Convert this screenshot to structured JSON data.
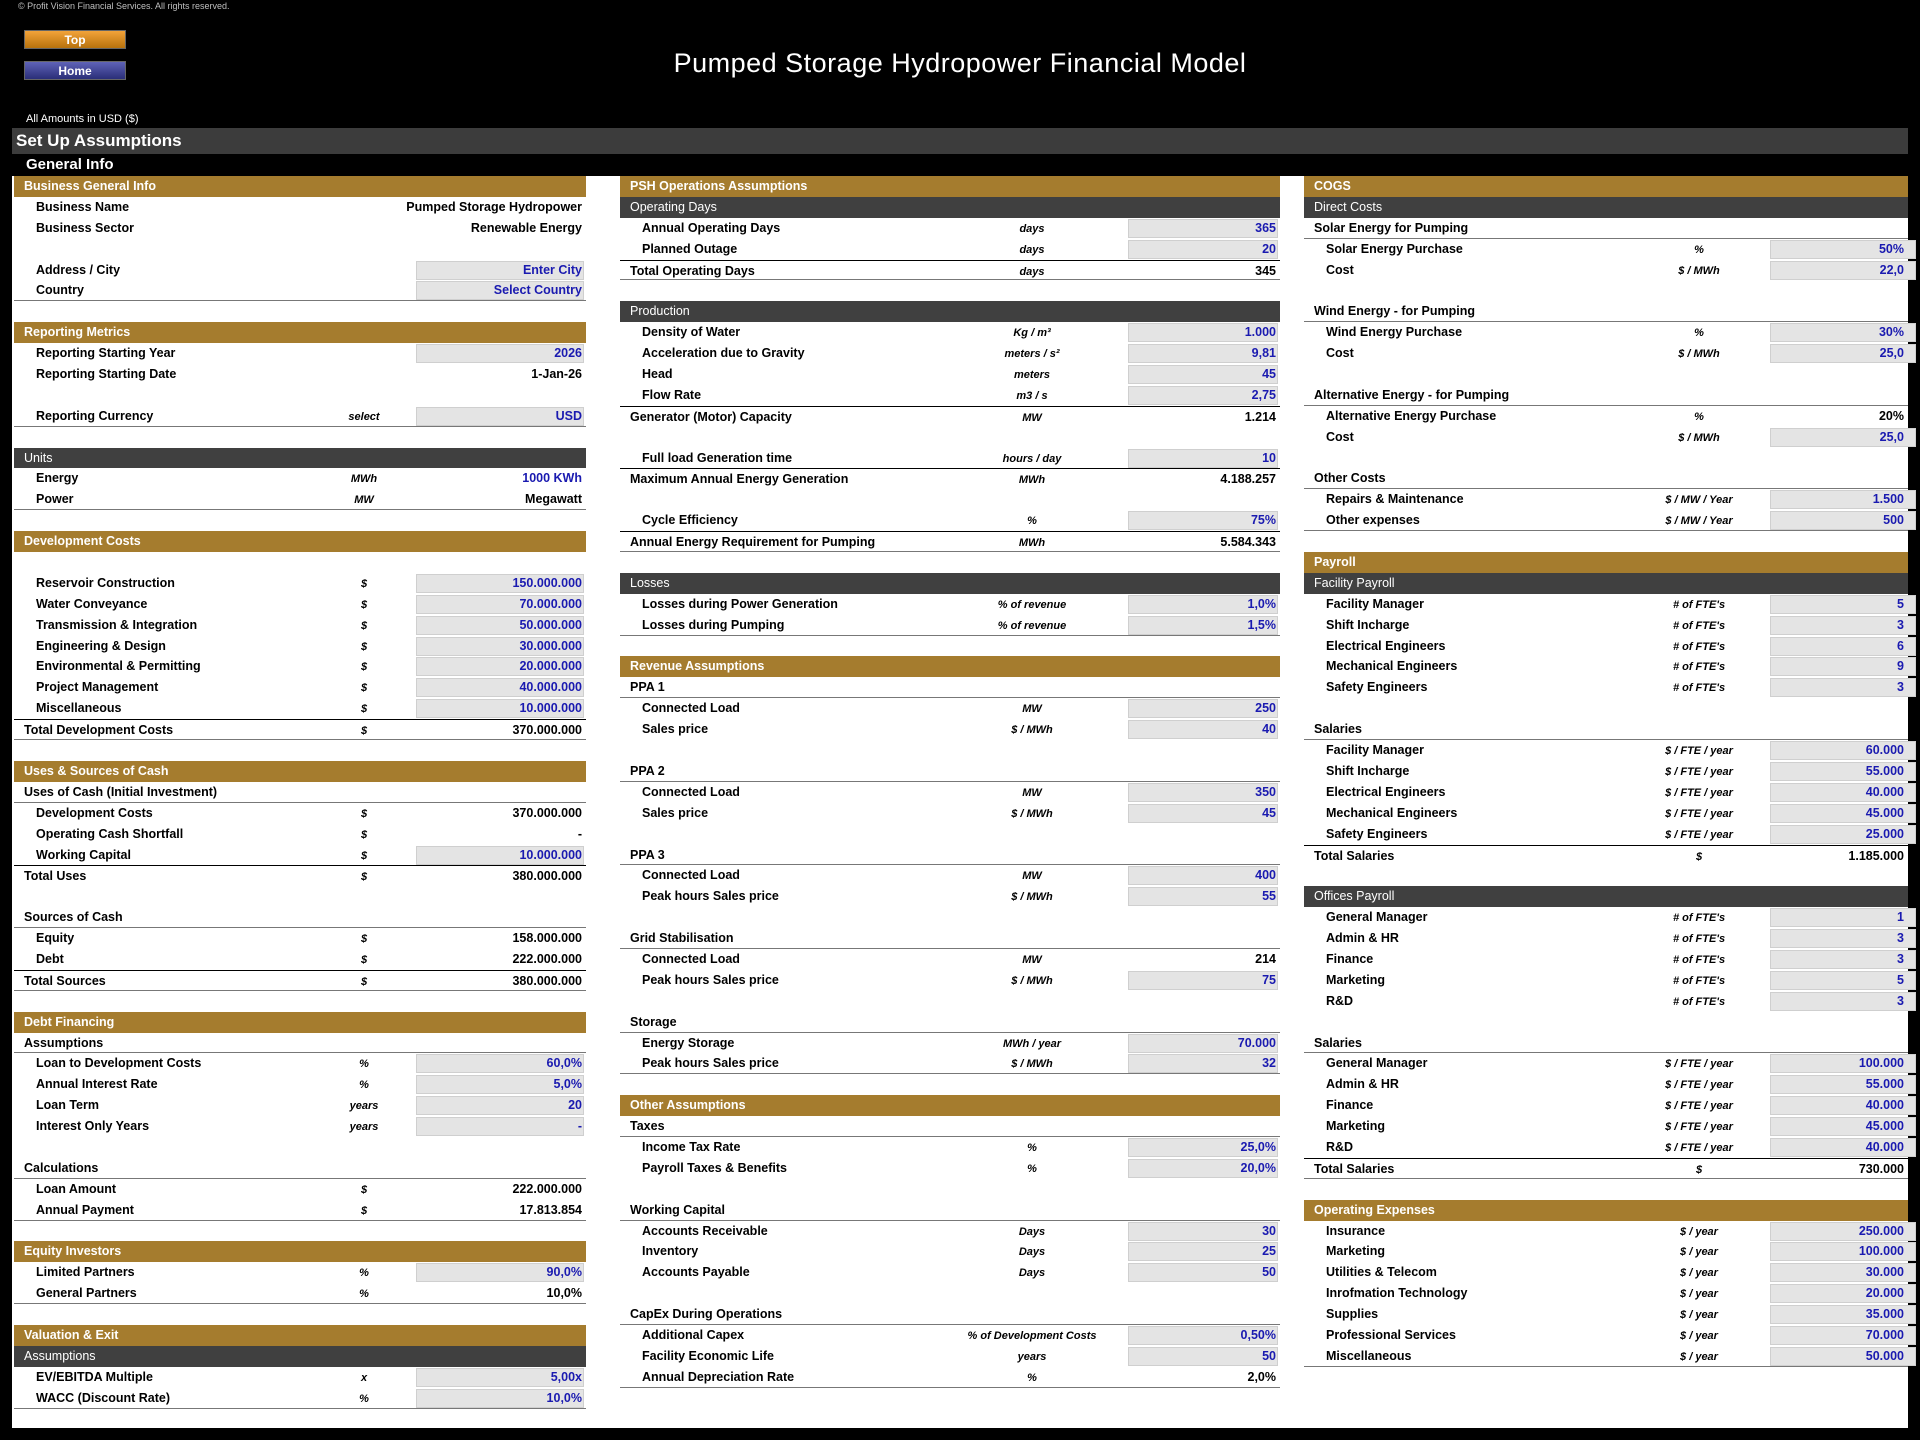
{
  "header": {
    "copyright": "© Profit Vision Financial Services. All rights reserved.",
    "top_button": "Top",
    "home_button": "Home",
    "title": "Pumped Storage Hydropower Financial Model",
    "amounts": "All Amounts in  USD ($)"
  },
  "setup_title": "Set Up Assumptions",
  "general_title": "General Info",
  "col1": [
    {
      "t": "sec",
      "l": "Business General Info"
    },
    {
      "t": "item",
      "l": "Business Name",
      "v": "Pumped Storage Hydropower"
    },
    {
      "t": "item",
      "l": "Business Sector",
      "v": "Renewable Energy"
    },
    {
      "t": "blank"
    },
    {
      "t": "item",
      "l": "Address / City",
      "v": "Enter City",
      "in": true
    },
    {
      "t": "item ul",
      "l": "Country",
      "v": "Select Country",
      "in": true
    },
    {
      "t": "blank"
    },
    {
      "t": "sec",
      "l": "Reporting Metrics"
    },
    {
      "t": "item",
      "l": "Reporting Starting Year",
      "v": "2026",
      "in": true
    },
    {
      "t": "item",
      "l": "Reporting Starting Date",
      "v": "1-Jan-26"
    },
    {
      "t": "blank"
    },
    {
      "t": "item ul",
      "l": "Reporting Currency",
      "u": "select",
      "v": "USD",
      "in": true
    },
    {
      "t": "blank"
    },
    {
      "t": "sub",
      "l": "Units"
    },
    {
      "t": "item",
      "l": "Energy",
      "u": "MWh",
      "v": "1000 KWh",
      "blue": true
    },
    {
      "t": "item ul",
      "l": "Power",
      "u": "MW",
      "v": "Megawatt"
    },
    {
      "t": "blank"
    },
    {
      "t": "sec",
      "l": "Development Costs"
    },
    {
      "t": "blank"
    },
    {
      "t": "item",
      "l": "Reservoir Construction",
      "u": "$",
      "v": "150.000.000",
      "in": true
    },
    {
      "t": "item",
      "l": "Water Conveyance",
      "u": "$",
      "v": "70.000.000",
      "in": true
    },
    {
      "t": "item",
      "l": "Transmission & Integration",
      "u": "$",
      "v": "50.000.000",
      "in": true
    },
    {
      "t": "item",
      "l": "Engineering & Design",
      "u": "$",
      "v": "30.000.000",
      "in": true
    },
    {
      "t": "item",
      "l": "Environmental & Permitting",
      "u": "$",
      "v": "20.000.000",
      "in": true
    },
    {
      "t": "item",
      "l": "Project Management",
      "u": "$",
      "v": "40.000.000",
      "in": true
    },
    {
      "t": "item",
      "l": "Miscellaneous",
      "u": "$",
      "v": "10.000.000",
      "in": true
    },
    {
      "t": "tot ul",
      "l": "Total Development Costs",
      "u": "$",
      "v": "370.000.000"
    },
    {
      "t": "blank"
    },
    {
      "t": "sec",
      "l": "Uses & Sources of Cash"
    },
    {
      "t": "grp ul",
      "l": "Uses of Cash (Initial Investment)"
    },
    {
      "t": "item",
      "l": "Development Costs",
      "u": "$",
      "v": "370.000.000"
    },
    {
      "t": "item",
      "l": "Operating Cash Shortfall",
      "u": "$",
      "v": "-"
    },
    {
      "t": "item",
      "l": "Working Capital",
      "u": "$",
      "v": "10.000.000",
      "in": true
    },
    {
      "t": "tot",
      "l": "Total Uses",
      "u": "$",
      "v": "380.000.000"
    },
    {
      "t": "blank"
    },
    {
      "t": "grp ul",
      "l": "Sources of Cash"
    },
    {
      "t": "item",
      "l": "Equity",
      "u": "$",
      "v": "158.000.000"
    },
    {
      "t": "item",
      "l": "Debt",
      "u": "$",
      "v": "222.000.000"
    },
    {
      "t": "tot ul",
      "l": "Total Sources",
      "u": "$",
      "v": "380.000.000"
    },
    {
      "t": "blank"
    },
    {
      "t": "sec",
      "l": "Debt Financing"
    },
    {
      "t": "grp ul",
      "l": "Assumptions"
    },
    {
      "t": "item",
      "l": "Loan to Development Costs",
      "u": "%",
      "v": "60,0%",
      "in": true
    },
    {
      "t": "item",
      "l": "Annual Interest Rate",
      "u": "%",
      "v": "5,0%",
      "in": true
    },
    {
      "t": "item",
      "l": "Loan Term",
      "u": "years",
      "v": "20",
      "in": true
    },
    {
      "t": "item",
      "l": "Interest Only Years",
      "u": "years",
      "v": "-",
      "in": true
    },
    {
      "t": "blank"
    },
    {
      "t": "grp ul",
      "l": "Calculations"
    },
    {
      "t": "item",
      "l": "Loan Amount",
      "u": "$",
      "v": "222.000.000"
    },
    {
      "t": "item ul",
      "l": "Annual Payment",
      "u": "$",
      "v": "17.813.854"
    },
    {
      "t": "blank"
    },
    {
      "t": "sec",
      "l": "Equity Investors"
    },
    {
      "t": "item",
      "l": "Limited Partners",
      "u": "%",
      "v": "90,0%",
      "in": true
    },
    {
      "t": "item ul",
      "l": "General Partners",
      "u": "%",
      "v": "10,0%"
    },
    {
      "t": "blank"
    },
    {
      "t": "sec",
      "l": "Valuation & Exit"
    },
    {
      "t": "sub",
      "l": "Assumptions"
    },
    {
      "t": "item",
      "l": "EV/EBITDA Multiple",
      "u": "x",
      "v": "5,00x",
      "in": true
    },
    {
      "t": "item ul",
      "l": "WACC (Discount Rate)",
      "u": "%",
      "v": "10,0%",
      "in": true
    }
  ],
  "col2": [
    {
      "t": "sec",
      "l": "PSH Operations Assumptions"
    },
    {
      "t": "sub",
      "l": "Operating Days"
    },
    {
      "t": "item",
      "l": "Annual Operating Days",
      "u": "days",
      "v": "365",
      "in": true
    },
    {
      "t": "item",
      "l": "Planned Outage",
      "u": "days",
      "v": "20",
      "in": true
    },
    {
      "t": "tot ul",
      "l": "Total Operating Days",
      "u": "days",
      "v": "345"
    },
    {
      "t": "blank"
    },
    {
      "t": "sub",
      "l": "Production"
    },
    {
      "t": "item",
      "l": "Density of Water",
      "u": "Kg / m³",
      "v": "1.000",
      "in": true
    },
    {
      "t": "item",
      "l": "Acceleration due to Gravity",
      "u": "meters / s²",
      "v": "9,81",
      "in": true
    },
    {
      "t": "item",
      "l": "Head",
      "u": "meters",
      "v": "45",
      "in": true
    },
    {
      "t": "item",
      "l": "Flow Rate",
      "u": "m3 / s",
      "v": "2,75",
      "in": true
    },
    {
      "t": "tot",
      "l": "Generator (Motor) Capacity",
      "u": "MW",
      "v": "1.214"
    },
    {
      "t": "blank"
    },
    {
      "t": "item",
      "l": "Full load Generation time",
      "u": "hours / day",
      "v": "10",
      "in": true
    },
    {
      "t": "tot",
      "l": "Maximum Annual Energy Generation",
      "u": "MWh",
      "v": "4.188.257"
    },
    {
      "t": "blank"
    },
    {
      "t": "item",
      "l": "Cycle Efficiency",
      "u": "%",
      "v": "75%",
      "in": true
    },
    {
      "t": "tot ul",
      "l": "Annual Energy Requirement for Pumping",
      "u": "MWh",
      "v": "5.584.343"
    },
    {
      "t": "blank"
    },
    {
      "t": "sub",
      "l": "Losses"
    },
    {
      "t": "item",
      "l": "Losses during Power Generation",
      "u": "% of revenue",
      "v": "1,0%",
      "in": true
    },
    {
      "t": "item ul",
      "l": "Losses during Pumping",
      "u": "% of revenue",
      "v": "1,5%",
      "in": true
    },
    {
      "t": "blank"
    },
    {
      "t": "sec",
      "l": "Revenue Assumptions"
    },
    {
      "t": "grp ul",
      "l": "PPA 1"
    },
    {
      "t": "item",
      "l": "Connected Load",
      "u": "MW",
      "v": "250",
      "in": true
    },
    {
      "t": "item",
      "l": "Sales price",
      "u": "$ / MWh",
      "v": "40",
      "in": true
    },
    {
      "t": "blank"
    },
    {
      "t": "grp ul",
      "l": "PPA 2"
    },
    {
      "t": "item",
      "l": "Connected Load",
      "u": "MW",
      "v": "350",
      "in": true
    },
    {
      "t": "item",
      "l": "Sales price",
      "u": "$ / MWh",
      "v": "45",
      "in": true
    },
    {
      "t": "blank"
    },
    {
      "t": "grp ul",
      "l": "PPA 3"
    },
    {
      "t": "item",
      "l": "Connected Load",
      "u": "MW",
      "v": "400",
      "in": true
    },
    {
      "t": "item",
      "l": "Peak hours Sales price",
      "u": "$ / MWh",
      "v": "55",
      "in": true
    },
    {
      "t": "blank"
    },
    {
      "t": "grp ul",
      "l": "Grid Stabilisation"
    },
    {
      "t": "item",
      "l": "Connected Load",
      "u": "MW",
      "v": "214"
    },
    {
      "t": "item",
      "l": "Peak hours Sales price",
      "u": "$ / MWh",
      "v": "75",
      "in": true
    },
    {
      "t": "blank"
    },
    {
      "t": "grp ul",
      "l": "Storage"
    },
    {
      "t": "item",
      "l": "Energy Storage",
      "u": "MWh / year",
      "v": "70.000",
      "in": true
    },
    {
      "t": "item ul",
      "l": "Peak hours Sales price",
      "u": "$ / MWh",
      "v": "32",
      "in": true
    },
    {
      "t": "blank"
    },
    {
      "t": "sec",
      "l": "Other Assumptions"
    },
    {
      "t": "grp ul",
      "l": "Taxes"
    },
    {
      "t": "item",
      "l": "Income Tax Rate",
      "u": "%",
      "v": "25,0%",
      "in": true
    },
    {
      "t": "item",
      "l": "Payroll Taxes & Benefits",
      "u": "%",
      "v": "20,0%",
      "in": true
    },
    {
      "t": "blank"
    },
    {
      "t": "grp ul",
      "l": "Working Capital"
    },
    {
      "t": "item",
      "l": "Accounts Receivable",
      "u": "Days",
      "v": "30",
      "in": true
    },
    {
      "t": "item",
      "l": "Inventory",
      "u": "Days",
      "v": "25",
      "in": true
    },
    {
      "t": "item",
      "l": "Accounts Payable",
      "u": "Days",
      "v": "50",
      "in": true
    },
    {
      "t": "blank"
    },
    {
      "t": "grp ul",
      "l": "CapEx During Operations"
    },
    {
      "t": "item",
      "l": "Additional Capex",
      "u": "% of Development Costs",
      "v": "0,50%",
      "in": true
    },
    {
      "t": "item",
      "l": "Facility Economic Life",
      "u": "years",
      "v": "50",
      "in": true
    },
    {
      "t": "item ul",
      "l": "Annual Depreciation Rate",
      "u": "%",
      "v": "2,0%"
    }
  ],
  "col3": [
    {
      "t": "sec",
      "l": "COGS"
    },
    {
      "t": "sub",
      "l": "Direct Costs"
    },
    {
      "t": "grp ul",
      "l": "Solar Energy for Pumping"
    },
    {
      "t": "item",
      "l": "Solar Energy Purchase",
      "u": "%",
      "v": "50%",
      "in": true
    },
    {
      "t": "item",
      "l": "Cost",
      "u": "$ / MWh",
      "v": "22,0",
      "in": true
    },
    {
      "t": "blank"
    },
    {
      "t": "grp ul",
      "l": "Wind Energy - for Pumping"
    },
    {
      "t": "item",
      "l": "Wind Energy Purchase",
      "u": "%",
      "v": "30%",
      "in": true
    },
    {
      "t": "item",
      "l": "Cost",
      "u": "$ / MWh",
      "v": "25,0",
      "in": true
    },
    {
      "t": "blank"
    },
    {
      "t": "grp ul",
      "l": "Alternative Energy - for Pumping"
    },
    {
      "t": "item",
      "l": "Alternative Energy Purchase",
      "u": "%",
      "v": "20%"
    },
    {
      "t": "item",
      "l": "Cost",
      "u": "$ / MWh",
      "v": "25,0",
      "in": true
    },
    {
      "t": "blank"
    },
    {
      "t": "grp ul",
      "l": "Other Costs"
    },
    {
      "t": "item",
      "l": "Repairs & Maintenance",
      "u": "$ / MW  / Year",
      "v": "1.500",
      "in": true
    },
    {
      "t": "item ul",
      "l": "Other expenses",
      "u": "$ / MW  / Year",
      "v": "500",
      "in": true
    },
    {
      "t": "blank"
    },
    {
      "t": "sec",
      "l": "Payroll"
    },
    {
      "t": "sub",
      "l": "Facility Payroll"
    },
    {
      "t": "item",
      "l": "Facility Manager",
      "u": "# of FTE's",
      "v": "5",
      "in": true
    },
    {
      "t": "item",
      "l": "Shift Incharge",
      "u": "# of FTE's",
      "v": "3",
      "in": true
    },
    {
      "t": "item",
      "l": "Electrical Engineers",
      "u": "# of FTE's",
      "v": "6",
      "in": true
    },
    {
      "t": "item",
      "l": "Mechanical Engineers",
      "u": "# of FTE's",
      "v": "9",
      "in": true
    },
    {
      "t": "item",
      "l": "Safety Engineers",
      "u": "# of FTE's",
      "v": "3",
      "in": true
    },
    {
      "t": "blank"
    },
    {
      "t": "grp ul",
      "l": "Salaries"
    },
    {
      "t": "item",
      "l": "Facility Manager",
      "u": "$ / FTE / year",
      "v": "60.000",
      "in": true
    },
    {
      "t": "item",
      "l": "Shift Incharge",
      "u": "$ / FTE / year",
      "v": "55.000",
      "in": true
    },
    {
      "t": "item",
      "l": "Electrical Engineers",
      "u": "$ / FTE / year",
      "v": "40.000",
      "in": true
    },
    {
      "t": "item",
      "l": "Mechanical Engineers",
      "u": "$ / FTE / year",
      "v": "45.000",
      "in": true
    },
    {
      "t": "item",
      "l": "Safety Engineers",
      "u": "$ / FTE / year",
      "v": "25.000",
      "in": true
    },
    {
      "t": "tot",
      "l": "Total Salaries",
      "u": "$",
      "v": "1.185.000"
    },
    {
      "t": "blank"
    },
    {
      "t": "sub",
      "l": "Offices Payroll"
    },
    {
      "t": "item",
      "l": "General Manager",
      "u": "# of FTE's",
      "v": "1",
      "in": true
    },
    {
      "t": "item",
      "l": "Admin & HR",
      "u": "# of FTE's",
      "v": "3",
      "in": true
    },
    {
      "t": "item",
      "l": "Finance",
      "u": "# of FTE's",
      "v": "3",
      "in": true
    },
    {
      "t": "item",
      "l": "Marketing",
      "u": "# of FTE's",
      "v": "5",
      "in": true
    },
    {
      "t": "item",
      "l": "R&D",
      "u": "# of FTE's",
      "v": "3",
      "in": true
    },
    {
      "t": "blank"
    },
    {
      "t": "grp ul",
      "l": "Salaries"
    },
    {
      "t": "item",
      "l": "General Manager",
      "u": "$ / FTE / year",
      "v": "100.000",
      "in": true
    },
    {
      "t": "item",
      "l": "Admin & HR",
      "u": "$ / FTE / year",
      "v": "55.000",
      "in": true
    },
    {
      "t": "item",
      "l": "Finance",
      "u": "$ / FTE / year",
      "v": "40.000",
      "in": true
    },
    {
      "t": "item",
      "l": "Marketing",
      "u": "$ / FTE / year",
      "v": "45.000",
      "in": true
    },
    {
      "t": "item",
      "l": "R&D",
      "u": "$ / FTE / year",
      "v": "40.000",
      "in": true
    },
    {
      "t": "tot ul",
      "l": "Total Salaries",
      "u": "$",
      "v": "730.000"
    },
    {
      "t": "blank"
    },
    {
      "t": "sec",
      "l": "Operating Expenses"
    },
    {
      "t": "item",
      "l": "Insurance",
      "u": "$ / year",
      "v": "250.000",
      "in": true
    },
    {
      "t": "item",
      "l": "Marketing",
      "u": "$ / year",
      "v": "100.000",
      "in": true
    },
    {
      "t": "item",
      "l": "Utilities & Telecom",
      "u": "$ / year",
      "v": "30.000",
      "in": true
    },
    {
      "t": "item",
      "l": "Inrofmation Technology",
      "u": "$ / year",
      "v": "20.000",
      "in": true
    },
    {
      "t": "item",
      "l": "Supplies",
      "u": "$ / year",
      "v": "35.000",
      "in": true
    },
    {
      "t": "item",
      "l": "Professional Services",
      "u": "$ / year",
      "v": "70.000",
      "in": true
    },
    {
      "t": "item ul",
      "l": "Miscellaneous",
      "u": "$ / year",
      "v": "50.000",
      "in": true
    }
  ]
}
